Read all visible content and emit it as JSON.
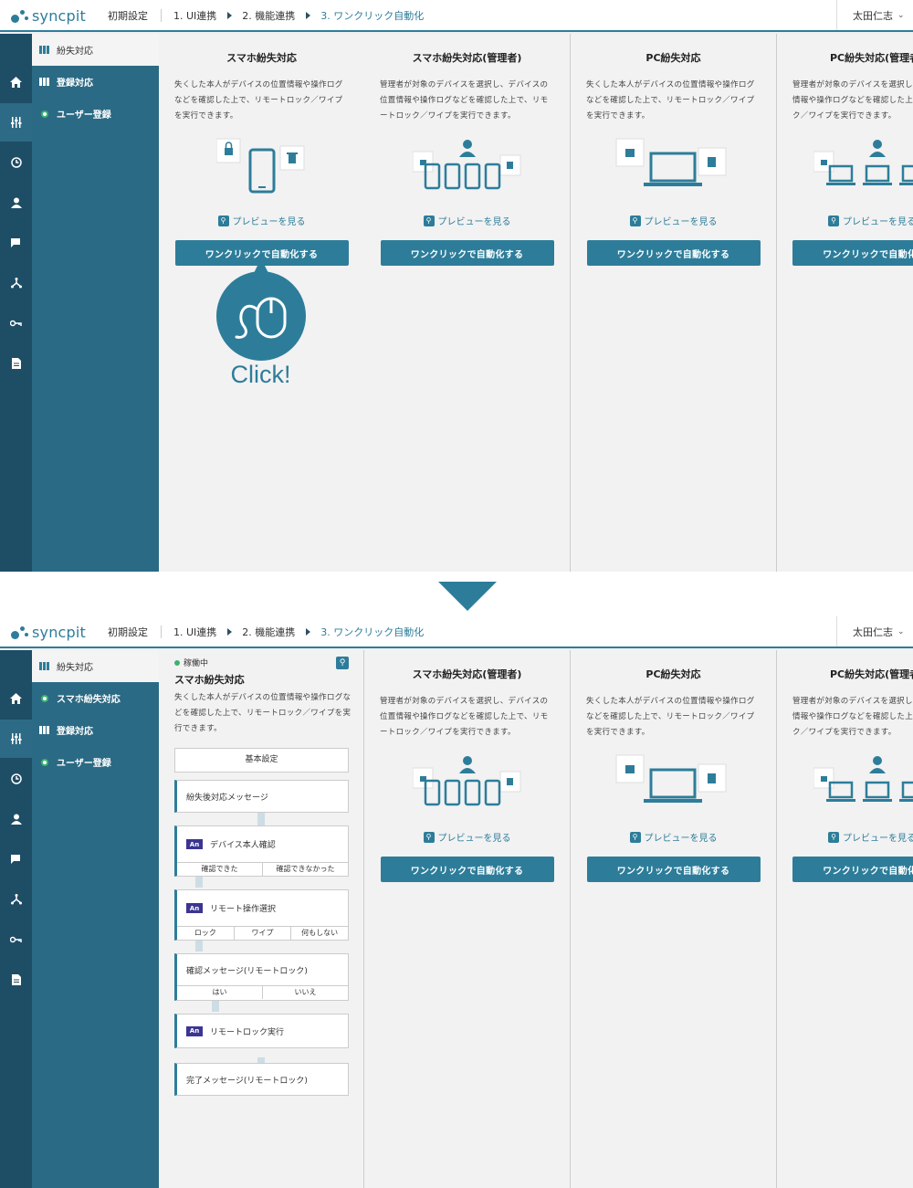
{
  "brand": {
    "name": "syncpit"
  },
  "breadcrumbs": {
    "initial": "初期設定",
    "step1": "1. UI連携",
    "step2": "2. 機能連携",
    "step3": "3. ワンクリック自動化"
  },
  "user": {
    "name": "太田仁志"
  },
  "rail_icons": [
    "home-icon",
    "sliders-icon",
    "history-icon",
    "person-icon",
    "chat-icon",
    "network-icon",
    "key-icon",
    "document-icon"
  ],
  "sidebar1": {
    "items": [
      {
        "label": "紛失対応"
      },
      {
        "label": "登録対応"
      },
      {
        "label": "ユーザー登録"
      }
    ]
  },
  "sidebar2": {
    "items": [
      {
        "label": "紛失対応"
      },
      {
        "label": "スマホ紛失対応"
      },
      {
        "label": "登録対応"
      },
      {
        "label": "ユーザー登録"
      }
    ]
  },
  "cards": [
    {
      "title": "スマホ紛失対応",
      "desc": "失くした本人がデバイスの位置情報や操作ログなどを確認した上で、リモートロック／ワイプを実行できます。",
      "preview": "プレビューを見る",
      "button": "ワンクリックで自動化する"
    },
    {
      "title": "スマホ紛失対応(管理者)",
      "desc": "管理者が対象のデバイスを選択し、デバイスの位置情報や操作ログなどを確認した上で、リモートロック／ワイプを実行できます。",
      "preview": "プレビューを見る",
      "button": "ワンクリックで自動化する"
    },
    {
      "title": "PC紛失対応",
      "desc": "失くした本人がデバイスの位置情報や操作ログなどを確認した上で、リモートロック／ワイプを実行できます。",
      "preview": "プレビューを見る",
      "button": "ワンクリックで自動化する"
    },
    {
      "title": "PC紛失対応(管理者)",
      "desc": "管理者が対象のデバイスを選択し、デバイスの位置情報や操作ログなどを確認した上で、リモートロック／ワイプを実行できます。",
      "preview": "プレビューを見る",
      "button": "ワンクリックで自動化する"
    }
  ],
  "callout": {
    "text": "Click!"
  },
  "flow": {
    "status": "稼働中",
    "title": "スマホ紛失対応",
    "desc": "失くした本人がデバイスの位置情報や操作ログなどを確認した上で、リモートロック／ワイプを実行できます。",
    "basic": "基本設定",
    "steps": [
      {
        "label": "紛失後対応メッセージ"
      },
      {
        "label": "デバイス本人確認",
        "badge": "An",
        "options": [
          "確認できた",
          "確認できなかった"
        ]
      },
      {
        "label": "リモート操作選択",
        "badge": "An",
        "options": [
          "ロック",
          "ワイプ",
          "何もしない"
        ]
      },
      {
        "label": "確認メッセージ(リモートロック)",
        "options": [
          "はい",
          "いいえ"
        ]
      },
      {
        "label": "リモートロック実行",
        "badge": "An"
      },
      {
        "label": "完了メッセージ(リモートロック)"
      }
    ]
  },
  "colors": {
    "accent": "#2d7d9a",
    "rail": "#1e4d66",
    "sidebar": "#2b6a84",
    "status": "#3cb371",
    "an_badge": "#3b3592"
  }
}
